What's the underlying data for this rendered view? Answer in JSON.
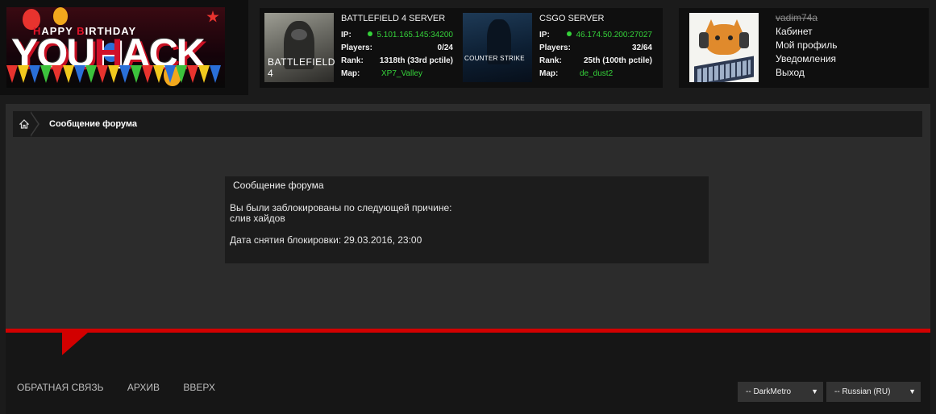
{
  "logo": {
    "top_text_1": "H",
    "top_text_2": "APPY ",
    "top_text_3": "B",
    "top_text_4": "IRTHDAY",
    "big_1": "YOU",
    "big_2": "H",
    "big_3": "ACK"
  },
  "servers": [
    {
      "title": "BATTLEFIELD 4 SERVER",
      "image_label": "BATTLEFIELD 4",
      "ip_label": "IP:",
      "ip": "5.101.165.145:34200",
      "players_label": "Players:",
      "players": "0/24",
      "rank_label": "Rank:",
      "rank": "1318th (33rd pctile)",
      "map_label": "Map:",
      "map": "XP7_Valley"
    },
    {
      "title": "CSGO SERVER",
      "image_label": "COUNTER STRIKE",
      "ip_label": "IP:",
      "ip": "46.174.50.200:27027",
      "players_label": "Players:",
      "players": "32/64",
      "rank_label": "Rank:",
      "rank": "25th (100th pctile)",
      "map_label": "Map:",
      "map": "de_dust2"
    }
  ],
  "user": {
    "name": "vadim74a",
    "menu": [
      "Кабинет",
      "Мой профиль",
      "Уведомления",
      "Выход"
    ]
  },
  "breadcrumb": {
    "current": "Сообщение форума"
  },
  "message": {
    "title": "Сообщение форума",
    "line1": "Вы были заблокированы по следующей причине:",
    "line2": "слив хайдов",
    "date": "Дата снятия блокировки: 29.03.2016, 23:00"
  },
  "footer": {
    "links": [
      "Обратная связь",
      "Архив",
      "Вверх"
    ],
    "style_select": "-- DarkMetro",
    "lang_select": "-- Russian (RU)"
  },
  "colors": {
    "accent": "#d20000",
    "online": "#35d23a",
    "background": "#1b1b1b"
  }
}
